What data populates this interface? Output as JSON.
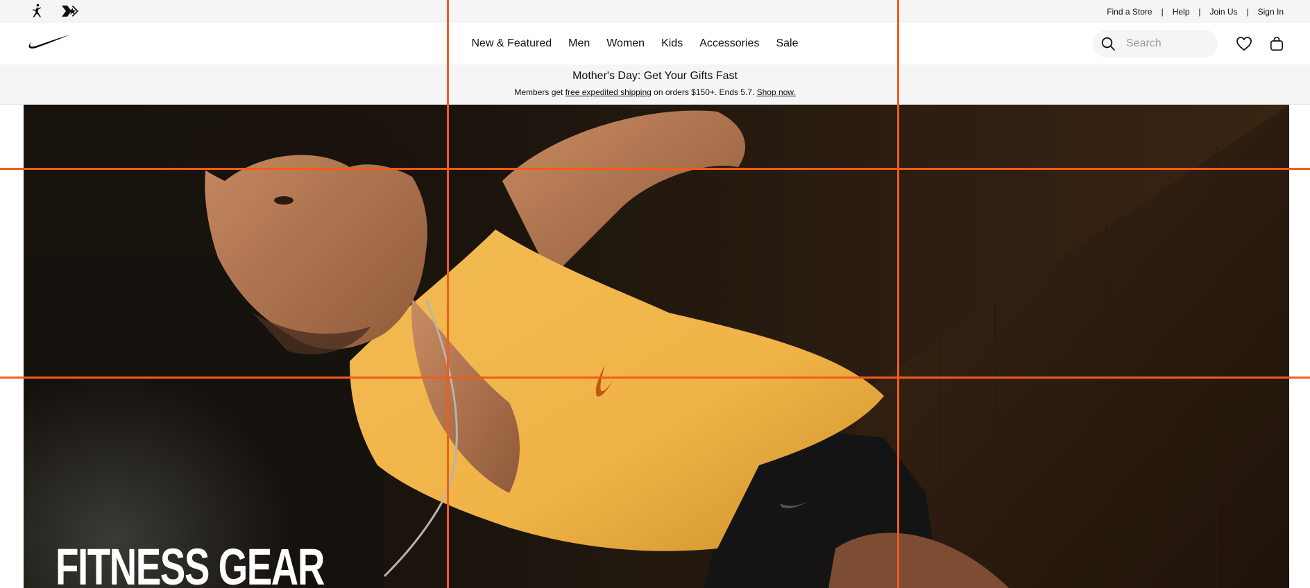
{
  "utility_bar": {
    "brands": [
      "jordan-icon",
      "converse-icon"
    ],
    "links": [
      "Find a Store",
      "Help",
      "Join Us",
      "Sign In"
    ],
    "separator": "|"
  },
  "header": {
    "logo": "nike-swoosh-icon",
    "nav": [
      "New & Featured",
      "Men",
      "Women",
      "Kids",
      "Accessories",
      "Sale"
    ],
    "search": {
      "placeholder": "Search",
      "value": ""
    },
    "icons": [
      "heart-icon",
      "bag-icon"
    ]
  },
  "promo": {
    "title": "Mother's Day: Get Your Gifts Fast",
    "sub_prefix": "Members get ",
    "sub_link": "free expedited shipping",
    "sub_middle": " on orders $150+. Ends 5.7. ",
    "cta": "Shop now."
  },
  "hero": {
    "headline": "FITNESS GEAR"
  },
  "colors": {
    "accent_line": "#f25c19",
    "shirt": "#f0b347",
    "background": "#f5f5f5"
  }
}
